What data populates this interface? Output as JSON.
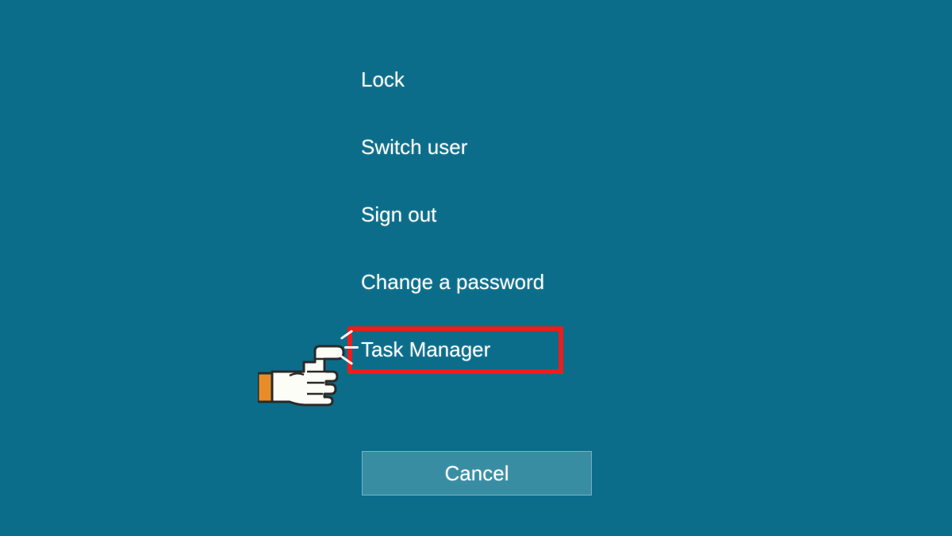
{
  "menu": {
    "items": [
      {
        "label": "Lock"
      },
      {
        "label": "Switch user"
      },
      {
        "label": "Sign out"
      },
      {
        "label": "Change a password"
      },
      {
        "label": "Task Manager"
      }
    ]
  },
  "cancel": {
    "label": "Cancel"
  },
  "colors": {
    "background": "#0b6d8a",
    "highlight": "#ee1c1c",
    "text": "#ffffff",
    "hand_cuff": "#e88c2a"
  }
}
